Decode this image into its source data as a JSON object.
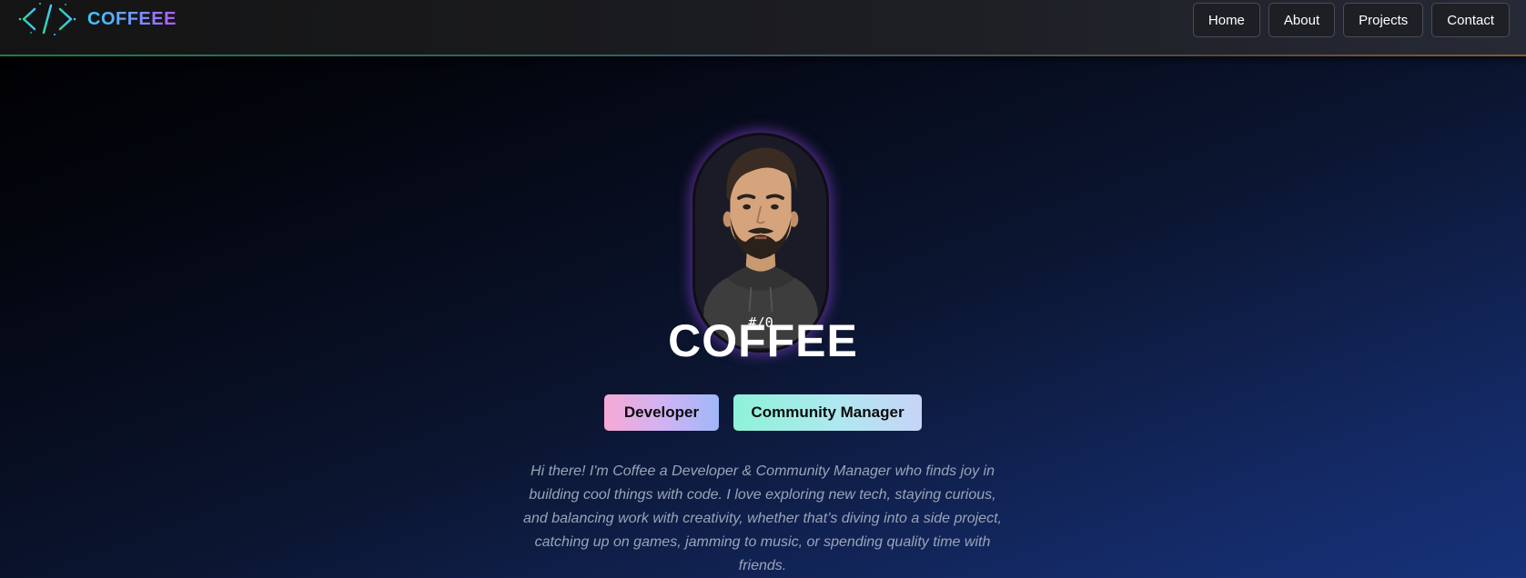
{
  "header": {
    "brand_name": "COFFEEE",
    "logo_icon": "code-brackets-icon",
    "nav": [
      {
        "label": "Home"
      },
      {
        "label": "About"
      },
      {
        "label": "Projects"
      },
      {
        "label": "Contact"
      }
    ]
  },
  "hero": {
    "avatar_icon": "avatar-illustration",
    "avatar_hoodie_text": "#/0",
    "title": "COFFEE",
    "roles": [
      {
        "label": "Developer"
      },
      {
        "label": "Community Manager"
      }
    ],
    "intro": "Hi there! I'm Coffee a Developer & Community Manager who finds joy in building cool things with code. I love exploring new tech, staying curious, and balancing work with creativity, whether that’s diving into a side project, catching up on games, jamming to music, or spending quality time with friends."
  },
  "colors": {
    "brand_gradient_start": "#3ec8ff",
    "brand_gradient_end": "#b45cff",
    "avatar_glow": "#9646e6",
    "intro_text": "#9aa4b8",
    "background_end": "#17327a"
  }
}
